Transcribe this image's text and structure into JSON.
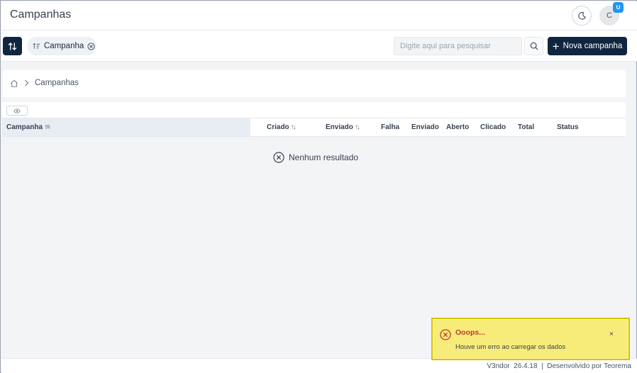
{
  "header": {
    "title": "Campanhas",
    "theme_icon": "moon-icon",
    "avatar_initial": "C",
    "avatar_badge": "U"
  },
  "toolbar": {
    "sort_icon": "sort-arrows-icon",
    "chip_label": "Campanha",
    "search_placeholder": "Digite aqui para pesquisar",
    "search_value": "",
    "new_button_label": "Nova campanha"
  },
  "breadcrumb": {
    "home_icon": "home-icon",
    "current": "Campanhas"
  },
  "table": {
    "columns": [
      {
        "label": "Campanha",
        "sortable": true
      },
      {
        "label": "Criado",
        "sortable": true
      },
      {
        "label": "Enviado",
        "sortable": true
      },
      {
        "label": "Falha",
        "sortable": false
      },
      {
        "label": "Enviado",
        "sortable": false
      },
      {
        "label": "Aberto",
        "sortable": false
      },
      {
        "label": "Clicado",
        "sortable": false
      },
      {
        "label": "Total",
        "sortable": false
      },
      {
        "label": "Status",
        "sortable": false
      }
    ],
    "rows": [],
    "empty_text": "Nenhum resultado"
  },
  "toast": {
    "title": "Ooops...",
    "message": "Houve um erro ao carregar os dados",
    "close": "×"
  },
  "footer": {
    "text": "V3ndor  26.4.18  |  Desenvolvido por Teorema"
  },
  "colors": {
    "primary": "#10253f",
    "badge": "#2196f3",
    "toast_bg": "#f7ec79",
    "toast_title": "#c0392b"
  }
}
